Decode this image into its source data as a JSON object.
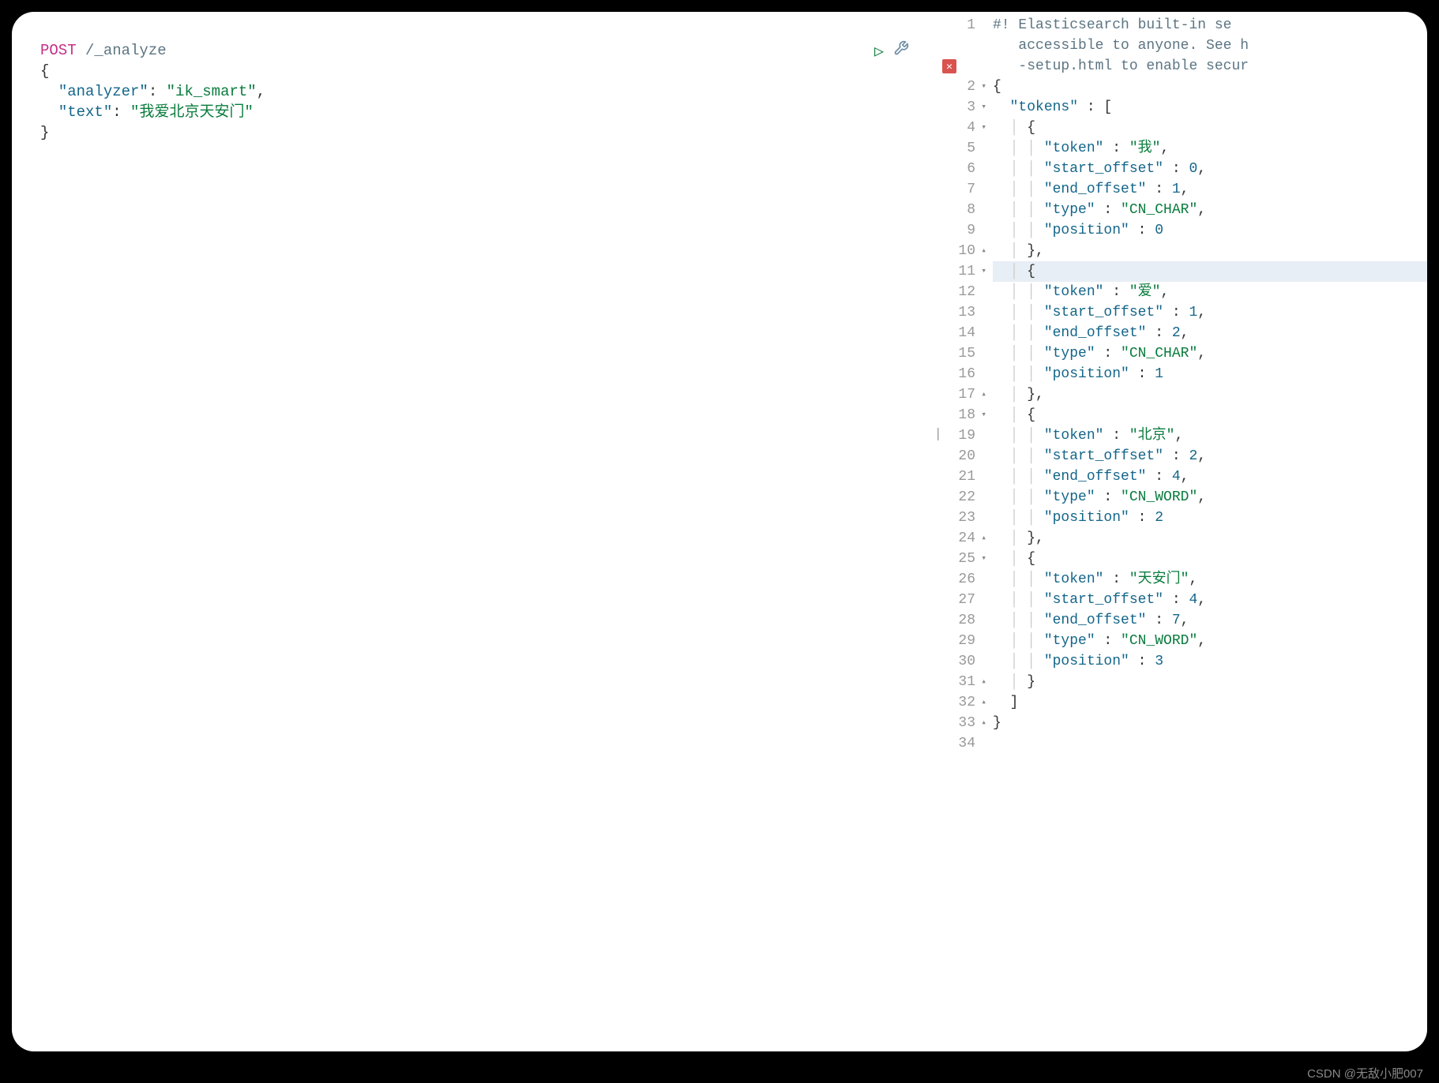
{
  "left_panel": {
    "method": "POST",
    "path": "/_analyze",
    "body_lines": [
      {
        "type": "punct",
        "text": "{"
      },
      {
        "type": "kv",
        "indent": "  ",
        "key": "\"analyzer\"",
        "value": "\"ik_smart\"",
        "comma": ","
      },
      {
        "type": "kv",
        "indent": "  ",
        "key": "\"text\"",
        "value": "\"我爱北京天安门\"",
        "comma": ""
      },
      {
        "type": "punct",
        "text": "}"
      }
    ]
  },
  "right_panel": {
    "lines": [
      {
        "num": "1",
        "fold": "",
        "content": [
          {
            "cls": "comment",
            "t": "#! Elasticsearch built-in se"
          }
        ],
        "hl": false
      },
      {
        "num": "",
        "fold": "",
        "content": [
          {
            "cls": "comment",
            "t": "   accessible to anyone. See h"
          }
        ],
        "hl": false
      },
      {
        "num": "",
        "fold": "",
        "content": [
          {
            "cls": "comment",
            "t": "   -setup.html to enable secur"
          }
        ],
        "hl": false
      },
      {
        "num": "2",
        "fold": "▾",
        "content": [
          {
            "cls": "punct",
            "t": "{"
          }
        ],
        "hl": false
      },
      {
        "num": "3",
        "fold": "▾",
        "content": [
          {
            "cls": "punct",
            "t": "  "
          },
          {
            "cls": "key",
            "t": "\"tokens\""
          },
          {
            "cls": "punct",
            "t": " : ["
          }
        ],
        "hl": false
      },
      {
        "num": "4",
        "fold": "▾",
        "content": [
          {
            "cls": "guide",
            "t": "  │ "
          },
          {
            "cls": "punct",
            "t": "{"
          }
        ],
        "hl": false
      },
      {
        "num": "5",
        "fold": "",
        "content": [
          {
            "cls": "guide",
            "t": "  │ │ "
          },
          {
            "cls": "key",
            "t": "\"token\""
          },
          {
            "cls": "punct",
            "t": " : "
          },
          {
            "cls": "string",
            "t": "\"我\""
          },
          {
            "cls": "punct",
            "t": ","
          }
        ],
        "hl": false
      },
      {
        "num": "6",
        "fold": "",
        "content": [
          {
            "cls": "guide",
            "t": "  │ │ "
          },
          {
            "cls": "key",
            "t": "\"start_offset\""
          },
          {
            "cls": "punct",
            "t": " : "
          },
          {
            "cls": "number",
            "t": "0"
          },
          {
            "cls": "punct",
            "t": ","
          }
        ],
        "hl": false
      },
      {
        "num": "7",
        "fold": "",
        "content": [
          {
            "cls": "guide",
            "t": "  │ │ "
          },
          {
            "cls": "key",
            "t": "\"end_offset\""
          },
          {
            "cls": "punct",
            "t": " : "
          },
          {
            "cls": "number",
            "t": "1"
          },
          {
            "cls": "punct",
            "t": ","
          }
        ],
        "hl": false
      },
      {
        "num": "8",
        "fold": "",
        "content": [
          {
            "cls": "guide",
            "t": "  │ │ "
          },
          {
            "cls": "key",
            "t": "\"type\""
          },
          {
            "cls": "punct",
            "t": " : "
          },
          {
            "cls": "string",
            "t": "\"CN_CHAR\""
          },
          {
            "cls": "punct",
            "t": ","
          }
        ],
        "hl": false
      },
      {
        "num": "9",
        "fold": "",
        "content": [
          {
            "cls": "guide",
            "t": "  │ │ "
          },
          {
            "cls": "key",
            "t": "\"position\""
          },
          {
            "cls": "punct",
            "t": " : "
          },
          {
            "cls": "number",
            "t": "0"
          }
        ],
        "hl": false
      },
      {
        "num": "10",
        "fold": "▴",
        "content": [
          {
            "cls": "guide",
            "t": "  │ "
          },
          {
            "cls": "punct",
            "t": "},"
          }
        ],
        "hl": false
      },
      {
        "num": "11",
        "fold": "▾",
        "content": [
          {
            "cls": "guide",
            "t": "  │ "
          },
          {
            "cls": "punct",
            "t": "{"
          }
        ],
        "hl": true
      },
      {
        "num": "12",
        "fold": "",
        "content": [
          {
            "cls": "guide",
            "t": "  │ │ "
          },
          {
            "cls": "key",
            "t": "\"token\""
          },
          {
            "cls": "punct",
            "t": " : "
          },
          {
            "cls": "string",
            "t": "\"爱\""
          },
          {
            "cls": "punct",
            "t": ","
          }
        ],
        "hl": false
      },
      {
        "num": "13",
        "fold": "",
        "content": [
          {
            "cls": "guide",
            "t": "  │ │ "
          },
          {
            "cls": "key",
            "t": "\"start_offset\""
          },
          {
            "cls": "punct",
            "t": " : "
          },
          {
            "cls": "number",
            "t": "1"
          },
          {
            "cls": "punct",
            "t": ","
          }
        ],
        "hl": false
      },
      {
        "num": "14",
        "fold": "",
        "content": [
          {
            "cls": "guide",
            "t": "  │ │ "
          },
          {
            "cls": "key",
            "t": "\"end_offset\""
          },
          {
            "cls": "punct",
            "t": " : "
          },
          {
            "cls": "number",
            "t": "2"
          },
          {
            "cls": "punct",
            "t": ","
          }
        ],
        "hl": false
      },
      {
        "num": "15",
        "fold": "",
        "content": [
          {
            "cls": "guide",
            "t": "  │ │ "
          },
          {
            "cls": "key",
            "t": "\"type\""
          },
          {
            "cls": "punct",
            "t": " : "
          },
          {
            "cls": "string",
            "t": "\"CN_CHAR\""
          },
          {
            "cls": "punct",
            "t": ","
          }
        ],
        "hl": false
      },
      {
        "num": "16",
        "fold": "",
        "content": [
          {
            "cls": "guide",
            "t": "  │ │ "
          },
          {
            "cls": "key",
            "t": "\"position\""
          },
          {
            "cls": "punct",
            "t": " : "
          },
          {
            "cls": "number",
            "t": "1"
          }
        ],
        "hl": false
      },
      {
        "num": "17",
        "fold": "▴",
        "content": [
          {
            "cls": "guide",
            "t": "  │ "
          },
          {
            "cls": "punct",
            "t": "},"
          }
        ],
        "hl": false
      },
      {
        "num": "18",
        "fold": "▾",
        "content": [
          {
            "cls": "guide",
            "t": "  │ "
          },
          {
            "cls": "punct",
            "t": "{"
          }
        ],
        "hl": false
      },
      {
        "num": "19",
        "fold": "",
        "content": [
          {
            "cls": "guide",
            "t": "  │ │ "
          },
          {
            "cls": "key",
            "t": "\"token\""
          },
          {
            "cls": "punct",
            "t": " : "
          },
          {
            "cls": "string",
            "t": "\"北京\""
          },
          {
            "cls": "punct",
            "t": ","
          }
        ],
        "hl": false
      },
      {
        "num": "20",
        "fold": "",
        "content": [
          {
            "cls": "guide",
            "t": "  │ │ "
          },
          {
            "cls": "key",
            "t": "\"start_offset\""
          },
          {
            "cls": "punct",
            "t": " : "
          },
          {
            "cls": "number",
            "t": "2"
          },
          {
            "cls": "punct",
            "t": ","
          }
        ],
        "hl": false
      },
      {
        "num": "21",
        "fold": "",
        "content": [
          {
            "cls": "guide",
            "t": "  │ │ "
          },
          {
            "cls": "key",
            "t": "\"end_offset\""
          },
          {
            "cls": "punct",
            "t": " : "
          },
          {
            "cls": "number",
            "t": "4"
          },
          {
            "cls": "punct",
            "t": ","
          }
        ],
        "hl": false
      },
      {
        "num": "22",
        "fold": "",
        "content": [
          {
            "cls": "guide",
            "t": "  │ │ "
          },
          {
            "cls": "key",
            "t": "\"type\""
          },
          {
            "cls": "punct",
            "t": " : "
          },
          {
            "cls": "string",
            "t": "\"CN_WORD\""
          },
          {
            "cls": "punct",
            "t": ","
          }
        ],
        "hl": false
      },
      {
        "num": "23",
        "fold": "",
        "content": [
          {
            "cls": "guide",
            "t": "  │ │ "
          },
          {
            "cls": "key",
            "t": "\"position\""
          },
          {
            "cls": "punct",
            "t": " : "
          },
          {
            "cls": "number",
            "t": "2"
          }
        ],
        "hl": false
      },
      {
        "num": "24",
        "fold": "▴",
        "content": [
          {
            "cls": "guide",
            "t": "  │ "
          },
          {
            "cls": "punct",
            "t": "},"
          }
        ],
        "hl": false
      },
      {
        "num": "25",
        "fold": "▾",
        "content": [
          {
            "cls": "guide",
            "t": "  │ "
          },
          {
            "cls": "punct",
            "t": "{"
          }
        ],
        "hl": false
      },
      {
        "num": "26",
        "fold": "",
        "content": [
          {
            "cls": "guide",
            "t": "  │ │ "
          },
          {
            "cls": "key",
            "t": "\"token\""
          },
          {
            "cls": "punct",
            "t": " : "
          },
          {
            "cls": "string",
            "t": "\"天安门\""
          },
          {
            "cls": "punct",
            "t": ","
          }
        ],
        "hl": false
      },
      {
        "num": "27",
        "fold": "",
        "content": [
          {
            "cls": "guide",
            "t": "  │ │ "
          },
          {
            "cls": "key",
            "t": "\"start_offset\""
          },
          {
            "cls": "punct",
            "t": " : "
          },
          {
            "cls": "number",
            "t": "4"
          },
          {
            "cls": "punct",
            "t": ","
          }
        ],
        "hl": false
      },
      {
        "num": "28",
        "fold": "",
        "content": [
          {
            "cls": "guide",
            "t": "  │ │ "
          },
          {
            "cls": "key",
            "t": "\"end_offset\""
          },
          {
            "cls": "punct",
            "t": " : "
          },
          {
            "cls": "number",
            "t": "7"
          },
          {
            "cls": "punct",
            "t": ","
          }
        ],
        "hl": false
      },
      {
        "num": "29",
        "fold": "",
        "content": [
          {
            "cls": "guide",
            "t": "  │ │ "
          },
          {
            "cls": "key",
            "t": "\"type\""
          },
          {
            "cls": "punct",
            "t": " : "
          },
          {
            "cls": "string",
            "t": "\"CN_WORD\""
          },
          {
            "cls": "punct",
            "t": ","
          }
        ],
        "hl": false
      },
      {
        "num": "30",
        "fold": "",
        "content": [
          {
            "cls": "guide",
            "t": "  │ │ "
          },
          {
            "cls": "key",
            "t": "\"position\""
          },
          {
            "cls": "punct",
            "t": " : "
          },
          {
            "cls": "number",
            "t": "3"
          }
        ],
        "hl": false
      },
      {
        "num": "31",
        "fold": "▴",
        "content": [
          {
            "cls": "guide",
            "t": "  │ "
          },
          {
            "cls": "punct",
            "t": "}"
          }
        ],
        "hl": false
      },
      {
        "num": "32",
        "fold": "▴",
        "content": [
          {
            "cls": "punct",
            "t": "  ]"
          }
        ],
        "hl": false
      },
      {
        "num": "33",
        "fold": "▴",
        "content": [
          {
            "cls": "punct",
            "t": "}"
          }
        ],
        "hl": false
      },
      {
        "num": "34",
        "fold": "",
        "content": [],
        "hl": false
      }
    ]
  },
  "watermark": "CSDN @无敌小肥007"
}
